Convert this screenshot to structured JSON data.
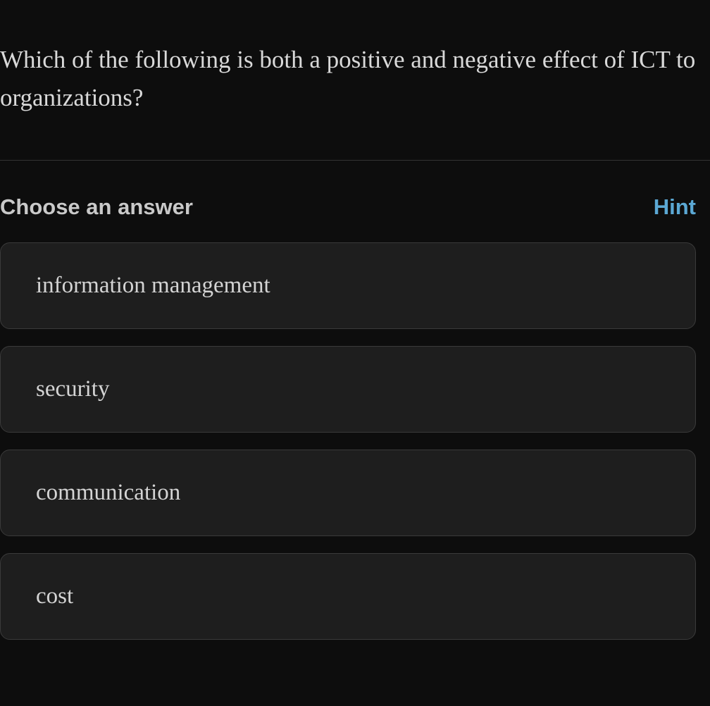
{
  "question": {
    "text": "Which of the following is both a positive and negative effect of ICT to organizations?"
  },
  "answer_section": {
    "prompt_label": "Choose an answer",
    "hint_label": "Hint"
  },
  "options": [
    {
      "label": "information management"
    },
    {
      "label": "security"
    },
    {
      "label": "communication"
    },
    {
      "label": "cost"
    }
  ]
}
